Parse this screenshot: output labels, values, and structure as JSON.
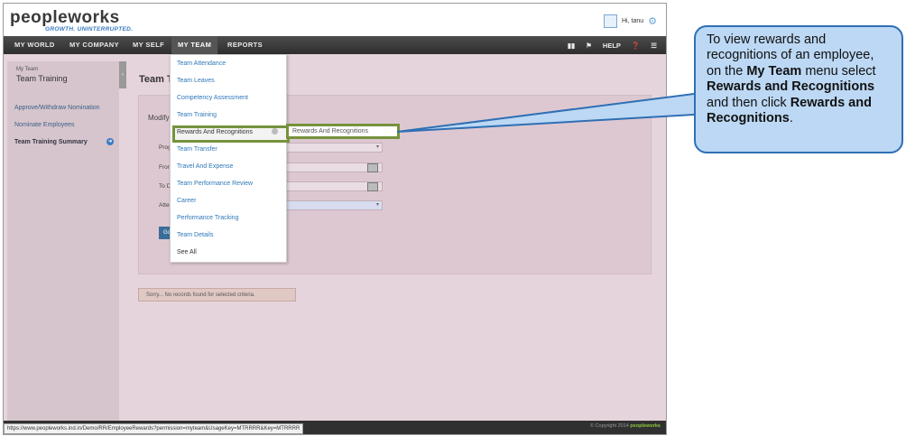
{
  "app": {
    "logo": "peopleworks",
    "tagline": "GROWTH. UNINTERRUPTED.",
    "user_greeting": "Hi, tanu"
  },
  "nav": {
    "items": [
      "MY WORLD",
      "MY COMPANY",
      "MY SELF",
      "MY TEAM",
      "REPORTS"
    ],
    "help": "HELP"
  },
  "sidebar": {
    "small_title": "My Team",
    "title": "Team Training",
    "links": [
      "Approve/Withdraw Nomination",
      "Nominate Employees",
      "Team Training Summary"
    ]
  },
  "page": {
    "title": "Team Training Summary",
    "modify_label": "Modify Search",
    "fields": [
      {
        "label": "Program"
      },
      {
        "label": "From Date"
      },
      {
        "label": "To Date"
      },
      {
        "label": "Attendance"
      }
    ],
    "go_label": "Go",
    "notice": "Sorry... No records found for selected criteria."
  },
  "dropdown": {
    "items": [
      "Team Attendance",
      "Team Leaves",
      "Competency Assessment",
      "Team Training",
      "Rewards And Recognitions",
      "Team Transfer",
      "Travel And Expense",
      "Team Performance Review",
      "Career",
      "Performance Tracking",
      "Team Details",
      "See All"
    ],
    "submenu_item": "Rewards And Recognitions"
  },
  "status": {
    "url": "https://www.peopleworks.ind.in/Demo/RR/EmployeeRewards?permission=myteam&UsageKey=MTRRRR&Key=MTRRRR",
    "copyright": "© Copyright 2014",
    "footer_logo": "peopleworks"
  },
  "callout": {
    "text_1": "To view rewards and recognitions of an employee, on the ",
    "bold_1": "My Team",
    "text_2": " menu select ",
    "bold_2": "Rewards and Recognitions",
    "text_3": " and then click ",
    "bold_3": "Rewards and Recognitions",
    "text_4": "."
  },
  "colors": {
    "highlight_border": "#76923c",
    "callout_fill": "#bcd8f4",
    "callout_border": "#2f6fb4",
    "menu_link": "#2e77b8"
  }
}
